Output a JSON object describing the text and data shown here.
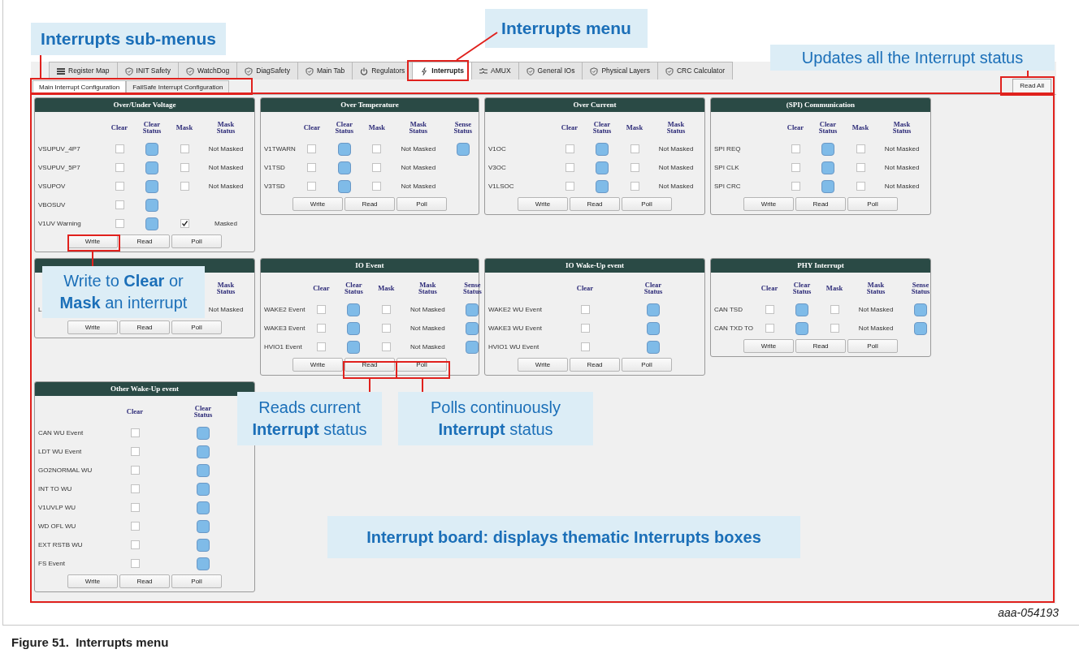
{
  "callouts": [
    {
      "text": "Interrupts sub-menus",
      "bold": true
    },
    {
      "text": "Interrupts menu",
      "bold": true
    },
    {
      "text": "Updates all the Interrupt status",
      "bold": false
    },
    {
      "text": "Write to **Clear** or **Mask** an interrupt",
      "bold": false
    },
    {
      "text": "Reads current **Interrupt** status",
      "bold": false
    },
    {
      "text": "Polls continuously **Interrupt** status",
      "bold": false
    },
    {
      "text": "Interrupt board: displays thematic Interrupts boxes",
      "bold": true
    }
  ],
  "tabs": [
    {
      "label": "Register Map",
      "kind": "grid",
      "selected": false
    },
    {
      "label": "INIT Safety",
      "kind": "shield",
      "selected": false
    },
    {
      "label": "WatchDog",
      "kind": "shield",
      "selected": false
    },
    {
      "label": "DiagSafety",
      "kind": "shield",
      "selected": false
    },
    {
      "label": "Main Tab",
      "kind": "shield",
      "selected": false
    },
    {
      "label": "Regulators",
      "kind": "power",
      "selected": false
    },
    {
      "label": "Interrupts",
      "kind": "bolt",
      "selected": true
    },
    {
      "label": "AMUX",
      "kind": "mux",
      "selected": false
    },
    {
      "label": "General IOs",
      "kind": "shield",
      "selected": false
    },
    {
      "label": "Physical Layers",
      "kind": "shield",
      "selected": false
    },
    {
      "label": "CRC Calculator",
      "kind": "shield",
      "selected": false
    }
  ],
  "subtabs": [
    {
      "label": "Main Interrupt Configuration",
      "selected": true
    },
    {
      "label": "FailSafe Interrupt Configuration",
      "selected": false
    }
  ],
  "read_all_button": "Read All",
  "panels": [
    {
      "title": "Over/Under Voltage",
      "columns": [
        {
          "label": "Clear",
          "kind": "checkbox"
        },
        {
          "label": "Clear Status",
          "kind": "led"
        },
        {
          "label": "Mask",
          "kind": "checkbox"
        },
        {
          "label": "Mask Status",
          "kind": "text"
        }
      ],
      "rows": [
        {
          "label": "VSUPUV_4P7",
          "cells": [
            {
              "kind": "checkbox",
              "checked": false
            },
            {
              "kind": "led"
            },
            {
              "kind": "checkbox",
              "checked": false
            },
            {
              "kind": "text",
              "text": "Not Masked"
            }
          ]
        },
        {
          "label": "VSUPUV_5P7",
          "cells": [
            {
              "kind": "checkbox",
              "checked": false
            },
            {
              "kind": "led"
            },
            {
              "kind": "checkbox",
              "checked": false
            },
            {
              "kind": "text",
              "text": "Not Masked"
            }
          ]
        },
        {
          "label": "VSUPOV",
          "cells": [
            {
              "kind": "checkbox",
              "checked": false
            },
            {
              "kind": "led"
            },
            {
              "kind": "checkbox",
              "checked": false
            },
            {
              "kind": "text",
              "text": "Not Masked"
            }
          ]
        },
        {
          "label": "VBOSUV",
          "cells": [
            {
              "kind": "checkbox",
              "checked": false
            },
            {
              "kind": "led"
            },
            {
              "kind": "none"
            },
            {
              "kind": "none"
            }
          ]
        },
        {
          "label": "V1UV Warning",
          "cells": [
            {
              "kind": "checkbox",
              "checked": false
            },
            {
              "kind": "led"
            },
            {
              "kind": "checkbox",
              "checked": true
            },
            {
              "kind": "text",
              "text": "Masked"
            }
          ]
        }
      ],
      "buttons": [
        "Write",
        "Read",
        "Poll"
      ]
    },
    {
      "title": "Over Temperature",
      "columns": [
        {
          "label": "Clear",
          "kind": "checkbox"
        },
        {
          "label": "Clear Status",
          "kind": "led"
        },
        {
          "label": "Mask",
          "kind": "checkbox"
        },
        {
          "label": "Mask Status",
          "kind": "text"
        },
        {
          "label": "Sense Status",
          "kind": "led"
        }
      ],
      "rows": [
        {
          "label": "V1TWARN",
          "cells": [
            {
              "kind": "checkbox",
              "checked": false
            },
            {
              "kind": "led"
            },
            {
              "kind": "checkbox",
              "checked": false
            },
            {
              "kind": "text",
              "text": "Not Masked"
            },
            {
              "kind": "led"
            }
          ]
        },
        {
          "label": "V1TSD",
          "cells": [
            {
              "kind": "checkbox",
              "checked": false
            },
            {
              "kind": "led"
            },
            {
              "kind": "checkbox",
              "checked": false
            },
            {
              "kind": "text",
              "text": "Not Masked"
            },
            {
              "kind": "none"
            }
          ]
        },
        {
          "label": "V3TSD",
          "cells": [
            {
              "kind": "checkbox",
              "checked": false
            },
            {
              "kind": "led"
            },
            {
              "kind": "checkbox",
              "checked": false
            },
            {
              "kind": "text",
              "text": "Not Masked"
            },
            {
              "kind": "none"
            }
          ]
        }
      ],
      "buttons": [
        "Write",
        "Read",
        "Poll"
      ]
    },
    {
      "title": "Over Current",
      "columns": [
        {
          "label": "Clear",
          "kind": "checkbox"
        },
        {
          "label": "Clear Status",
          "kind": "led"
        },
        {
          "label": "Mask",
          "kind": "checkbox"
        },
        {
          "label": "Mask Status",
          "kind": "text"
        }
      ],
      "rows": [
        {
          "label": "V1OC",
          "cells": [
            {
              "kind": "checkbox",
              "checked": false
            },
            {
              "kind": "led"
            },
            {
              "kind": "checkbox",
              "checked": false
            },
            {
              "kind": "text",
              "text": "Not Masked"
            }
          ]
        },
        {
          "label": "V3OC",
          "cells": [
            {
              "kind": "checkbox",
              "checked": false
            },
            {
              "kind": "led"
            },
            {
              "kind": "checkbox",
              "checked": false
            },
            {
              "kind": "text",
              "text": "Not Masked"
            }
          ]
        },
        {
          "label": "V1LSOC",
          "cells": [
            {
              "kind": "checkbox",
              "checked": false
            },
            {
              "kind": "led"
            },
            {
              "kind": "checkbox",
              "checked": false
            },
            {
              "kind": "text",
              "text": "Not Masked"
            }
          ]
        }
      ],
      "buttons": [
        "Write",
        "Read",
        "Poll"
      ]
    },
    {
      "title": "(SPI) Communication",
      "columns": [
        {
          "label": "Clear",
          "kind": "checkbox"
        },
        {
          "label": "Clear Status",
          "kind": "led"
        },
        {
          "label": "Mask",
          "kind": "checkbox"
        },
        {
          "label": "Mask Status",
          "kind": "text"
        }
      ],
      "rows": [
        {
          "label": "SPI REQ",
          "cells": [
            {
              "kind": "checkbox",
              "checked": false
            },
            {
              "kind": "led"
            },
            {
              "kind": "checkbox",
              "checked": false
            },
            {
              "kind": "text",
              "text": "Not Masked"
            }
          ]
        },
        {
          "label": "SPI CLK",
          "cells": [
            {
              "kind": "checkbox",
              "checked": false
            },
            {
              "kind": "led"
            },
            {
              "kind": "checkbox",
              "checked": false
            },
            {
              "kind": "text",
              "text": "Not Masked"
            }
          ]
        },
        {
          "label": "SPI CRC",
          "cells": [
            {
              "kind": "checkbox",
              "checked": false
            },
            {
              "kind": "led"
            },
            {
              "kind": "checkbox",
              "checked": false
            },
            {
              "kind": "text",
              "text": "Not Masked"
            }
          ]
        }
      ],
      "buttons": [
        "Write",
        "Read",
        "Poll"
      ]
    },
    {
      "columns": [
        {
          "kind": "checkbox"
        },
        {
          "kind": "led"
        },
        {
          "kind": "checkbox"
        },
        {
          "label": "Mask Status",
          "kind": "text"
        }
      ],
      "rows": [
        {
          "label": "L",
          "cells": [
            {
              "kind": "none"
            },
            {
              "kind": "none"
            },
            {
              "kind": "none"
            },
            {
              "kind": "text",
              "text": "Not Masked"
            }
          ]
        }
      ],
      "buttons": [
        "Write",
        "Read",
        "Poll"
      ]
    },
    {
      "title": "IO Event",
      "columns": [
        {
          "label": "Clear",
          "kind": "checkbox"
        },
        {
          "label": "Clear Status",
          "kind": "led"
        },
        {
          "label": "Mask",
          "kind": "checkbox"
        },
        {
          "label": "Mask Status",
          "kind": "text"
        },
        {
          "label": "Sense Status",
          "kind": "led"
        }
      ],
      "rows": [
        {
          "label": "WAKE2 Event",
          "cells": [
            {
              "kind": "checkbox",
              "checked": false
            },
            {
              "kind": "led"
            },
            {
              "kind": "checkbox",
              "checked": false
            },
            {
              "kind": "text",
              "text": "Not Masked"
            },
            {
              "kind": "led"
            }
          ]
        },
        {
          "label": "WAKE3 Event",
          "cells": [
            {
              "kind": "checkbox",
              "checked": false
            },
            {
              "kind": "led"
            },
            {
              "kind": "checkbox",
              "checked": false
            },
            {
              "kind": "text",
              "text": "Not Masked"
            },
            {
              "kind": "led"
            }
          ]
        },
        {
          "label": "HVIO1 Event",
          "cells": [
            {
              "kind": "checkbox",
              "checked": false
            },
            {
              "kind": "led"
            },
            {
              "kind": "checkbox",
              "checked": false
            },
            {
              "kind": "text",
              "text": "Not Masked"
            },
            {
              "kind": "led"
            }
          ]
        }
      ],
      "buttons": [
        "Write",
        "Read",
        "Poll"
      ]
    },
    {
      "title": "IO Wake-Up event",
      "columns": [
        {
          "label": "Clear",
          "kind": "checkbox"
        },
        {
          "label": "Clear Status",
          "kind": "led"
        }
      ],
      "rows": [
        {
          "label": "WAKE2 WU Event",
          "cells": [
            {
              "kind": "checkbox",
              "checked": false
            },
            {
              "kind": "led"
            }
          ]
        },
        {
          "label": "WAKE3 WU Event",
          "cells": [
            {
              "kind": "checkbox",
              "checked": false
            },
            {
              "kind": "led"
            }
          ]
        },
        {
          "label": "HVIO1 WU Event",
          "cells": [
            {
              "kind": "checkbox",
              "checked": false
            },
            {
              "kind": "led"
            }
          ]
        }
      ],
      "buttons": [
        "Write",
        "Read",
        "Poll"
      ]
    },
    {
      "title": "PHY Interrupt",
      "columns": [
        {
          "label": "Clear",
          "kind": "checkbox"
        },
        {
          "label": "Clear Status",
          "kind": "led"
        },
        {
          "label": "Mask",
          "kind": "checkbox"
        },
        {
          "label": "Mask Status",
          "kind": "text"
        },
        {
          "label": "Sense Status",
          "kind": "led"
        }
      ],
      "rows": [
        {
          "label": "CAN TSD",
          "cells": [
            {
              "kind": "checkbox",
              "checked": false
            },
            {
              "kind": "led"
            },
            {
              "kind": "checkbox",
              "checked": false
            },
            {
              "kind": "text",
              "text": "Not Masked"
            },
            {
              "kind": "led"
            }
          ]
        },
        {
          "label": "CAN TXD TO",
          "cells": [
            {
              "kind": "checkbox",
              "checked": false
            },
            {
              "kind": "led"
            },
            {
              "kind": "checkbox",
              "checked": false
            },
            {
              "kind": "text",
              "text": "Not Masked"
            },
            {
              "kind": "led"
            }
          ]
        }
      ],
      "buttons": [
        "Write",
        "Read",
        "Poll"
      ]
    },
    {
      "title": "Other Wake-Up event",
      "columns": [
        {
          "label": "Clear",
          "kind": "checkbox"
        },
        {
          "label": "Clear Status",
          "kind": "led"
        }
      ],
      "rows": [
        {
          "label": "CAN WU Event",
          "cells": [
            {
              "kind": "checkbox",
              "checked": false
            },
            {
              "kind": "led"
            }
          ]
        },
        {
          "label": "LDT WU Event",
          "cells": [
            {
              "kind": "checkbox",
              "checked": false
            },
            {
              "kind": "led"
            }
          ]
        },
        {
          "label": "GO2NORMAL WU",
          "cells": [
            {
              "kind": "checkbox",
              "checked": false
            },
            {
              "kind": "led"
            }
          ]
        },
        {
          "label": "INT TO WU",
          "cells": [
            {
              "kind": "checkbox",
              "checked": false
            },
            {
              "kind": "led"
            }
          ]
        },
        {
          "label": "V1UVLP WU",
          "cells": [
            {
              "kind": "checkbox",
              "checked": false
            },
            {
              "kind": "led"
            }
          ]
        },
        {
          "label": "WD OFL WU",
          "cells": [
            {
              "kind": "checkbox",
              "checked": false
            },
            {
              "kind": "led"
            }
          ]
        },
        {
          "label": "EXT RSTB WU",
          "cells": [
            {
              "kind": "checkbox",
              "checked": false
            },
            {
              "kind": "led"
            }
          ]
        },
        {
          "label": "FS Event",
          "cells": [
            {
              "kind": "checkbox",
              "checked": false
            },
            {
              "kind": "led"
            }
          ]
        }
      ],
      "buttons": [
        "Write",
        "Read",
        "Poll"
      ]
    }
  ],
  "figure_id": "aaa-054193",
  "caption": "Figure 51.  Interrupts menu"
}
